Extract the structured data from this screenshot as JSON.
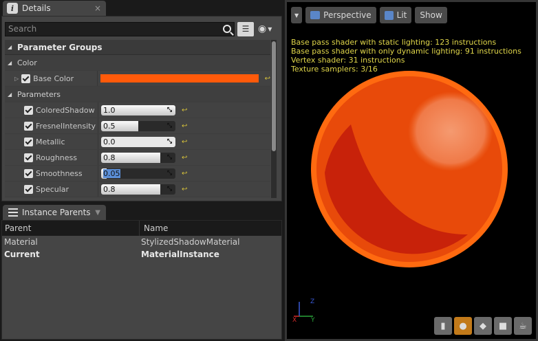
{
  "details": {
    "tab_title": "Details",
    "tab_close": "×",
    "search_placeholder": "Search",
    "group_title": "Parameter Groups",
    "color_category": "Color",
    "base_color_label": "Base Color",
    "base_color_value": "#ff5a0a",
    "parameters_category": "Parameters",
    "parameters": [
      {
        "label": "ColoredShadow",
        "value": "1.0",
        "fill": 1.0
      },
      {
        "label": "FresnelIntensity",
        "value": "0.5",
        "fill": 0.5
      },
      {
        "label": "Metallic",
        "value": "0.0",
        "fill": 0.0
      },
      {
        "label": "Roughness",
        "value": "0.8",
        "fill": 0.8
      },
      {
        "label": "Smoothness",
        "value": "0.05",
        "fill": 0.05
      },
      {
        "label": "Specular",
        "value": "0.8",
        "fill": 0.8
      }
    ]
  },
  "instance_parents": {
    "tab_title": "Instance Parents",
    "columns": [
      "Parent",
      "Name"
    ],
    "rows": [
      {
        "parent": "Material",
        "name": "StylizedShadowMaterial"
      },
      {
        "parent": "Current",
        "name": "MaterialInstance"
      }
    ]
  },
  "viewport": {
    "perspective_label": "Perspective",
    "lit_label": "Lit",
    "show_label": "Show",
    "stats": [
      "Base pass shader with static lighting: 123 instructions",
      "Base pass shader with only dynamic lighting: 91 instructions",
      "Vertex shader: 31 instructions",
      "Texture samplers: 3/16"
    ]
  }
}
